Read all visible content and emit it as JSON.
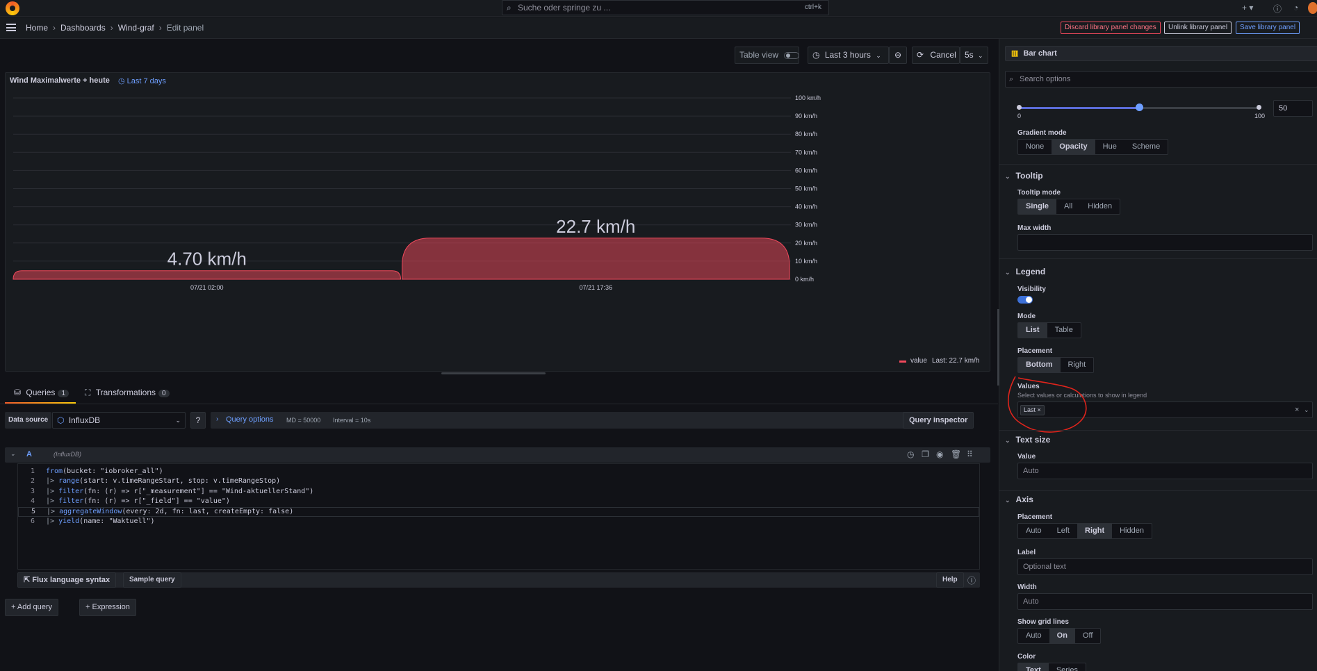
{
  "topbar": {
    "search_placeholder": "Suche oder springe zu ...",
    "search_shortcut": "ctrl+k",
    "add_label": "+"
  },
  "breadcrumb": [
    "Home",
    "Dashboards",
    "Wind-graf",
    "Edit panel"
  ],
  "header_buttons": {
    "discard": "Discard library panel changes",
    "unlink": "Unlink library panel",
    "save": "Save library panel"
  },
  "toolbar": {
    "table_view": "Table view",
    "time_range": "Last 3 hours",
    "cancel": "Cancel",
    "refresh": "5s"
  },
  "panel": {
    "title": "Wind Maximalwerte + heute",
    "time_badge": "Last 7 days",
    "legend_series": "value",
    "legend_value": "Last: 22.7 km/h"
  },
  "chart_data": {
    "type": "bar",
    "categories": [
      "07/21 02:00",
      "07/21 17:36"
    ],
    "values": [
      4.7,
      22.7
    ],
    "value_labels": [
      "4.70 km/h",
      "22.7 km/h"
    ],
    "y_ticks": [
      "0 km/h",
      "10 km/h",
      "20 km/h",
      "30 km/h",
      "40 km/h",
      "50 km/h",
      "60 km/h",
      "70 km/h",
      "80 km/h",
      "90 km/h",
      "100 km/h"
    ],
    "ylim": [
      0,
      100
    ],
    "y_axis_placement": "right",
    "grid": true,
    "legend_placement": "bottom-right",
    "bar_color": "#f2495c"
  },
  "query_tabs": {
    "queries": "Queries",
    "queries_count": "1",
    "transformations": "Transformations",
    "transformations_count": "0"
  },
  "query_row": {
    "datasource_label": "Data source",
    "datasource": "InfluxDB",
    "query_options": "Query options",
    "md": "MD = 50000",
    "interval": "Interval = 10s",
    "inspector": "Query inspector"
  },
  "query_a": {
    "ref": "A",
    "source": "(InfluxDB)",
    "lines": [
      {
        "n": "1",
        "pre": "",
        "kw": "from",
        "rest": "(bucket: \"iobroker_all\")"
      },
      {
        "n": "2",
        "pre": "|> ",
        "kw": "range",
        "rest": "(start: v.timeRangeStart, stop: v.timeRangeStop)"
      },
      {
        "n": "3",
        "pre": "|> ",
        "kw": "filter",
        "rest": "(fn: (r) => r[\"_measurement\"] == \"Wind-aktuellerStand\")"
      },
      {
        "n": "4",
        "pre": "|> ",
        "kw": "filter",
        "rest": "(fn: (r) => r[\"_field\"] == \"value\")"
      },
      {
        "n": "5",
        "pre": "|> ",
        "kw": "aggregateWindow",
        "rest": "(every: 2d, fn: last, createEmpty: false)"
      },
      {
        "n": "6",
        "pre": "|> ",
        "kw": "yield",
        "rest": "(name: \"Waktuell\")"
      }
    ]
  },
  "editor_footer": {
    "flux_syntax": "Flux language syntax",
    "sample_query": "Sample query",
    "help": "Help"
  },
  "bottom_buttons": {
    "add_query": "Add query",
    "expression": "Expression"
  },
  "options": {
    "viz_type": "Bar chart",
    "search_placeholder": "Search options",
    "slider_min": "0",
    "slider_max": "100",
    "slider_value": "50",
    "slider_fraction": 0.5,
    "gradient_mode_label": "Gradient mode",
    "gradient_modes": [
      "None",
      "Opacity",
      "Hue",
      "Scheme"
    ],
    "gradient_selected": "Opacity",
    "tooltip": {
      "title": "Tooltip",
      "mode_label": "Tooltip mode",
      "modes": [
        "Single",
        "All",
        "Hidden"
      ],
      "selected": "Single",
      "max_width_label": "Max width"
    },
    "legend": {
      "title": "Legend",
      "visibility_label": "Visibility",
      "visibility_on": true,
      "mode_label": "Mode",
      "modes": [
        "List",
        "Table"
      ],
      "mode_selected": "List",
      "placement_label": "Placement",
      "placements": [
        "Bottom",
        "Right"
      ],
      "placement_selected": "Bottom",
      "values_label": "Values",
      "values_sub": "Select values or calculations to show in legend",
      "values_tag": "Last"
    },
    "text_size": {
      "title": "Text size",
      "value_label": "Value",
      "value_placeholder": "Auto"
    },
    "axis": {
      "title": "Axis",
      "placement_label": "Placement",
      "placements": [
        "Auto",
        "Left",
        "Right",
        "Hidden"
      ],
      "placement_selected": "Right",
      "label_label": "Label",
      "label_placeholder": "Optional text",
      "width_label": "Width",
      "width_placeholder": "Auto",
      "grid_label": "Show grid lines",
      "grid_options": [
        "Auto",
        "On",
        "Off"
      ],
      "grid_selected": "On",
      "color_label": "Color",
      "color_options": [
        "Text",
        "Series"
      ],
      "color_selected": "Text"
    }
  }
}
